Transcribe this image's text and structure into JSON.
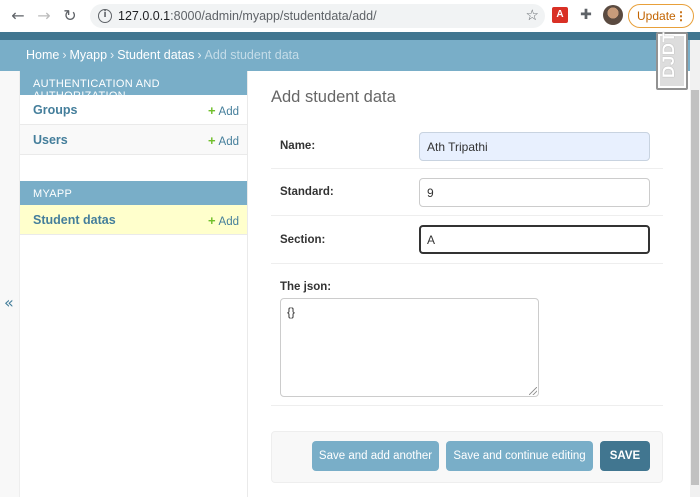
{
  "browser": {
    "url_host": "127.0.0.1",
    "url_rest": ":8000/admin/myapp/studentdata/add/",
    "update_label": "Update",
    "update_menu": "⋮"
  },
  "djdt": {
    "label": "DJDT"
  },
  "breadcrumbs": {
    "home": "Home",
    "app": "Myapp",
    "model": "Student datas",
    "current": "Add student data",
    "sep": "›"
  },
  "sidebar": {
    "collapse_glyph": "«",
    "modules": [
      {
        "caption": "Authentication and Authorization",
        "items": [
          {
            "label": "Groups",
            "add": "Add",
            "plus": "+"
          },
          {
            "label": "Users",
            "add": "Add",
            "plus": "+"
          }
        ]
      },
      {
        "caption": "Myapp",
        "items": [
          {
            "label": "Student datas",
            "add": "Add",
            "plus": "+"
          }
        ]
      }
    ]
  },
  "content": {
    "title": "Add student data",
    "fields": {
      "name": {
        "label": "Name:",
        "value": "Ath Tripathi"
      },
      "standard": {
        "label": "Standard:",
        "value": "9"
      },
      "section": {
        "label": "Section:",
        "value": "A"
      },
      "json": {
        "label": "The json:",
        "value": "{}"
      }
    },
    "buttons": {
      "save_add_another": "Save and add another",
      "save_continue": "Save and continue editing",
      "save": "SAVE"
    }
  },
  "colors": {
    "header": "#417690",
    "breadcrumbs": "#79aec8",
    "link": "#447e9b",
    "add_plus": "#70bf2b",
    "current_row": "#ffffcc"
  }
}
